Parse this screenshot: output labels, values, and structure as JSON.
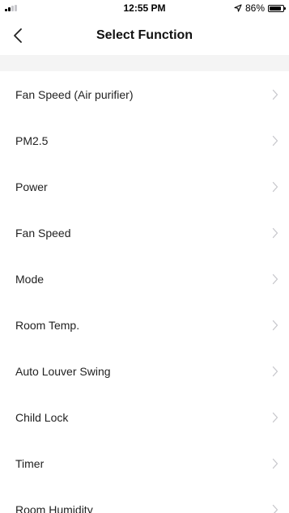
{
  "status_bar": {
    "time": "12:55 PM",
    "battery": "86%",
    "signal_icon": "signal-bars-icon",
    "location_icon": "location-arrow-icon",
    "battery_icon": "battery-icon"
  },
  "nav": {
    "title": "Select Function",
    "back_icon": "chevron-left-icon"
  },
  "items": [
    {
      "label": "Fan Speed (Air purifier)"
    },
    {
      "label": "PM2.5"
    },
    {
      "label": "Power"
    },
    {
      "label": "Fan Speed"
    },
    {
      "label": "Mode"
    },
    {
      "label": "Room Temp."
    },
    {
      "label": "Auto Louver Swing"
    },
    {
      "label": "Child Lock"
    },
    {
      "label": "Timer"
    },
    {
      "label": "Room Humidity"
    }
  ],
  "colors": {
    "band": "#f4f4f4",
    "chevron": "#c7c7cc",
    "text": "#222222"
  }
}
